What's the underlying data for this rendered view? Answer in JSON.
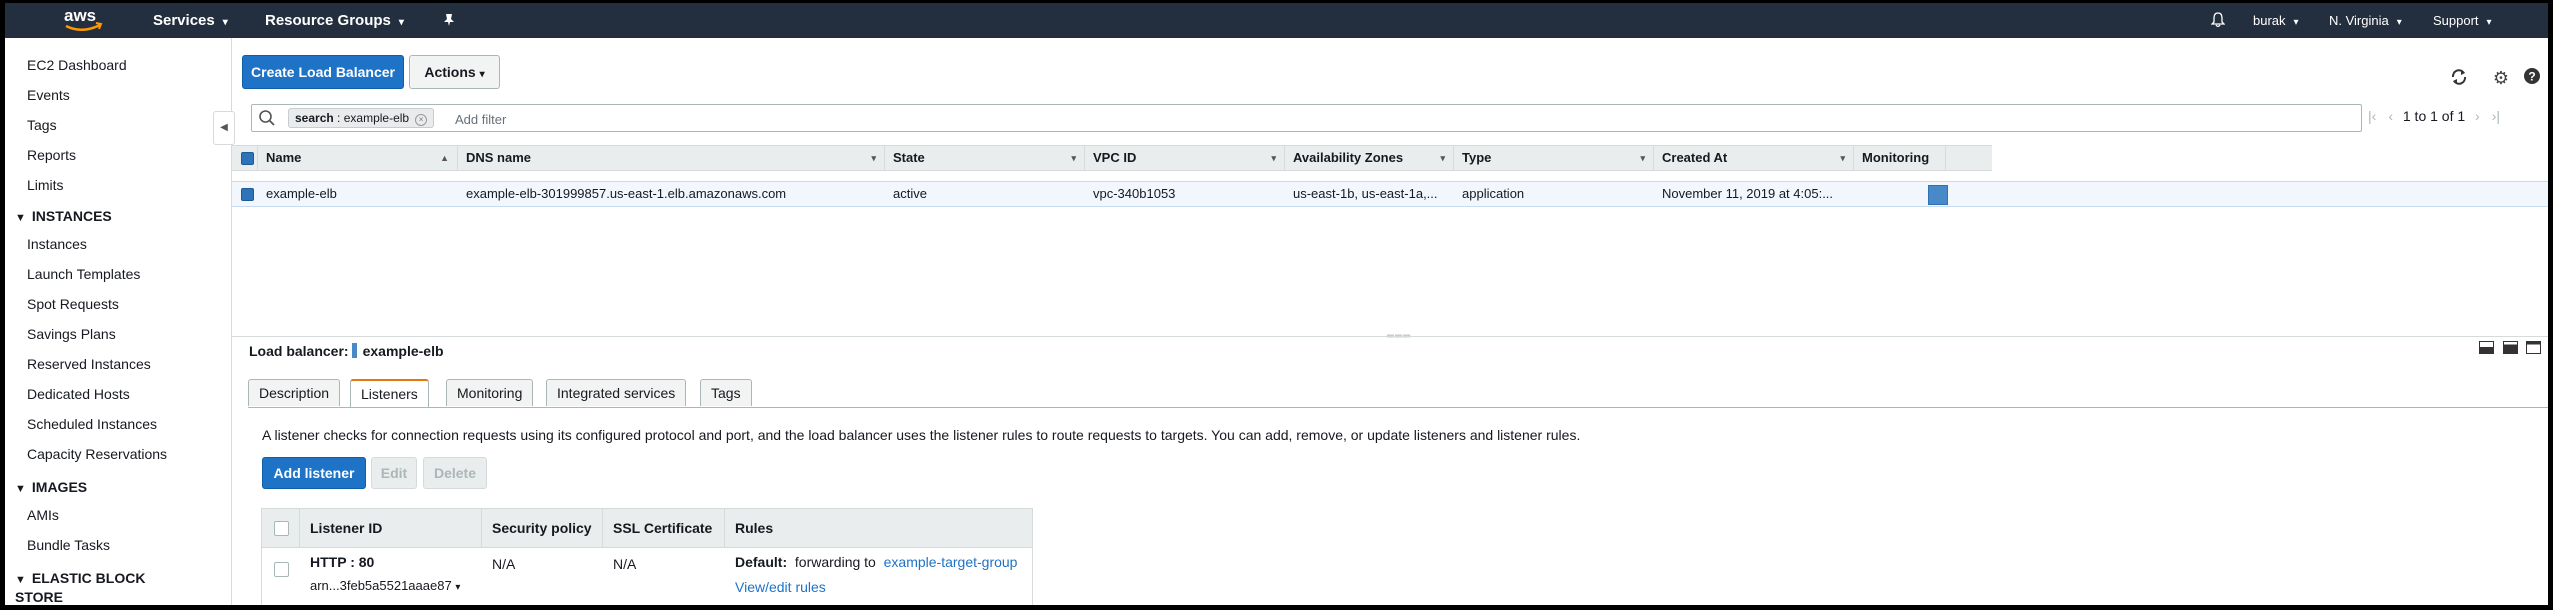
{
  "topnav": {
    "logo_text": "aws",
    "services": "Services",
    "resource_groups": "Resource Groups",
    "user": "burak",
    "region": "N. Virginia",
    "support": "Support"
  },
  "sidebar": {
    "items_top": [
      "EC2 Dashboard",
      "Events",
      "Tags",
      "Reports",
      "Limits"
    ],
    "section_instances": "INSTANCES",
    "items_instances": [
      "Instances",
      "Launch Templates",
      "Spot Requests",
      "Savings Plans",
      "Reserved Instances",
      "Dedicated Hosts",
      "Scheduled Instances",
      "Capacity Reservations"
    ],
    "section_images": "IMAGES",
    "items_images": [
      "AMIs",
      "Bundle Tasks"
    ],
    "section_ebs": "ELASTIC BLOCK STORE"
  },
  "toolbar": {
    "create_label": "Create Load Balancer",
    "actions_label": "Actions"
  },
  "filter": {
    "token_key": "search",
    "token_value": "example-elb",
    "placeholder": "Add filter"
  },
  "pager": {
    "text": "1 to 1 of 1"
  },
  "table": {
    "columns": [
      "Name",
      "DNS name",
      "State",
      "VPC ID",
      "Availability Zones",
      "Type",
      "Created At",
      "Monitoring"
    ],
    "row": {
      "name": "example-elb",
      "dns": "example-elb-301999857.us-east-1.elb.amazonaws.com",
      "state": "active",
      "vpc": "vpc-340b1053",
      "azs": "us-east-1b, us-east-1a,...",
      "type": "application",
      "created": "November 11, 2019 at 4:05:..."
    }
  },
  "detail": {
    "label": "Load balancer:",
    "name": "example-elb",
    "tabs": [
      "Description",
      "Listeners",
      "Monitoring",
      "Integrated services",
      "Tags"
    ],
    "active_tab": "Listeners",
    "description": "A listener checks for connection requests using its configured protocol and port, and the load balancer uses the listener rules to route requests to targets. You can add, remove, or update listeners and listener rules.",
    "add_label": "Add listener",
    "edit_label": "Edit",
    "delete_label": "Delete"
  },
  "listeners": {
    "columns": [
      "Listener ID",
      "Security policy",
      "SSL Certificate",
      "Rules"
    ],
    "row": {
      "id": "HTTP : 80",
      "arn": "arn...3feb5a5521aaae87",
      "security_policy": "N/A",
      "ssl": "N/A",
      "rule_default": "Default:",
      "rule_text": "forwarding to",
      "target_group": "example-target-group",
      "view_edit": "View/edit rules"
    }
  },
  "colors": {
    "nav_bg": "#232f3e",
    "primary": "#1e73c7",
    "active_tab": "#e47911",
    "selected_row": "#f1f7fd"
  }
}
